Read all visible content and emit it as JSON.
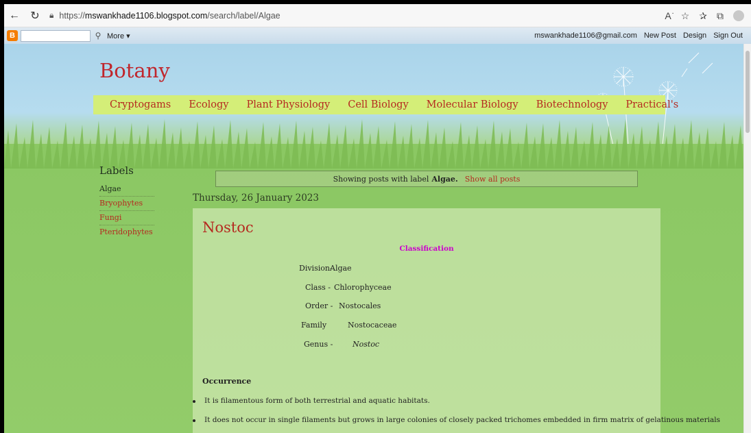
{
  "browser": {
    "url_prefix": "https://",
    "url_host": "mswankhade1106.blogspot.com",
    "url_path": "/search/label/Algae",
    "icons": [
      "back-icon",
      "refresh-icon",
      "lock-icon",
      "read-aloud-icon",
      "favorites-add-icon",
      "favorites-icon",
      "collections-icon",
      "profile-icon"
    ]
  },
  "blogger_bar": {
    "logo": "B",
    "more_label": "More ▾",
    "email": "mswankhade1106@gmail.com",
    "new_post": "New Post",
    "design": "Design",
    "sign_out": "Sign Out"
  },
  "blog": {
    "title": "Botany",
    "tabs": [
      "Cryptogams",
      "Ecology",
      "Plant Physiology",
      "Cell Biology",
      "Molecular Biology",
      "Biotechnology",
      "Practical's"
    ]
  },
  "sidebar": {
    "title": "Labels",
    "items": [
      "Algae",
      "Bryophytes",
      "Fungi",
      "Pteridophytes"
    ]
  },
  "status": {
    "prefix": "Showing posts with label",
    "label": "Algae.",
    "show_all": "Show all posts"
  },
  "date_header": "Thursday, 26 January 2023",
  "post": {
    "title": "Nostoc",
    "classification": "Classification",
    "taxonomy": [
      {
        "rank": "Division-",
        "value": "Algae"
      },
      {
        "rank": "Class -",
        "value": "Chlorophyceae"
      },
      {
        "rank": "Order -",
        "value": "Nostocales"
      },
      {
        "rank": "Family",
        "value": "Nostocaceae"
      },
      {
        "rank": "Genus -",
        "value": "Nostoc"
      }
    ],
    "occurrence_heading": "Occurrence",
    "bullets": [
      "It is filamentous form of both terrestrial and aquatic habitats.",
      "It does not occur in single filaments but grows in large colonies of closely packed trichomes embedded in firm matrix of gelatinous materials"
    ]
  },
  "colors": {
    "title_red": "#c0262c",
    "link_red": "#b52a20",
    "tab_bar": "#d4ee78",
    "classification_magenta": "#cc00cc"
  }
}
